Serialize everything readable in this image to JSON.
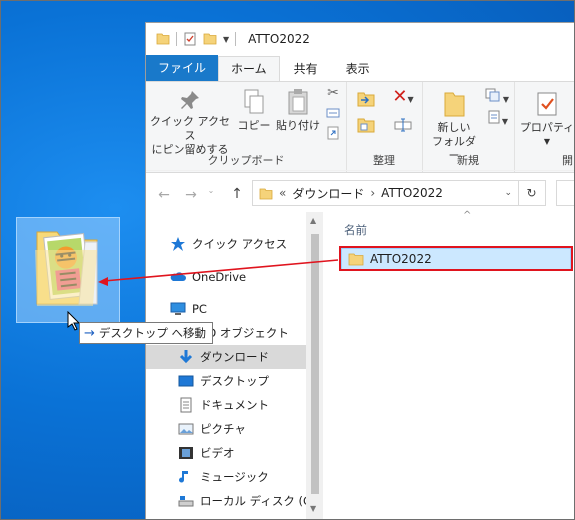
{
  "window": {
    "title": "ATTO2022",
    "tabs": [
      "ファイル",
      "ホーム",
      "共有",
      "表示"
    ]
  },
  "ribbon": {
    "pin_label_1": "クイック アクセス",
    "pin_label_2": "にピン留めする",
    "copy_label": "コピー",
    "paste_label": "貼り付け",
    "group_clipboard": "クリップボード",
    "group_organize": "整理",
    "new_folder_1": "新しい",
    "new_folder_2": "フォルダー",
    "group_new": "新規",
    "properties_label": "プロパティ",
    "group_open": "開く"
  },
  "address": {
    "prefix": "«",
    "crumb1": "ダウンロード",
    "sep": "›",
    "crumb2": "ATTO2022"
  },
  "nav": {
    "items": [
      {
        "label": "クイック アクセス",
        "icon": "star-icon"
      },
      {
        "label": "OneDrive",
        "icon": "cloud-icon"
      },
      {
        "label": "PC",
        "icon": "pc-icon"
      },
      {
        "label": "3D オブジェクト",
        "icon": "3d-icon"
      },
      {
        "label": "ダウンロード",
        "icon": "download-icon"
      },
      {
        "label": "デスクトップ",
        "icon": "desktop-icon"
      },
      {
        "label": "ドキュメント",
        "icon": "document-icon"
      },
      {
        "label": "ピクチャ",
        "icon": "picture-icon"
      },
      {
        "label": "ビデオ",
        "icon": "video-icon"
      },
      {
        "label": "ミュージック",
        "icon": "music-icon"
      },
      {
        "label": "ローカル ディスク (C:)",
        "icon": "disk-icon"
      }
    ]
  },
  "content": {
    "column_name": "名前",
    "folder": "ATTO2022"
  },
  "drag": {
    "tooltip_action": "デスクトップ へ移動"
  },
  "colors": {
    "accent": "#1979ca",
    "selection": "#cce8ff",
    "highlight_box": "#e0141e",
    "desktop": "#0a72d6"
  }
}
